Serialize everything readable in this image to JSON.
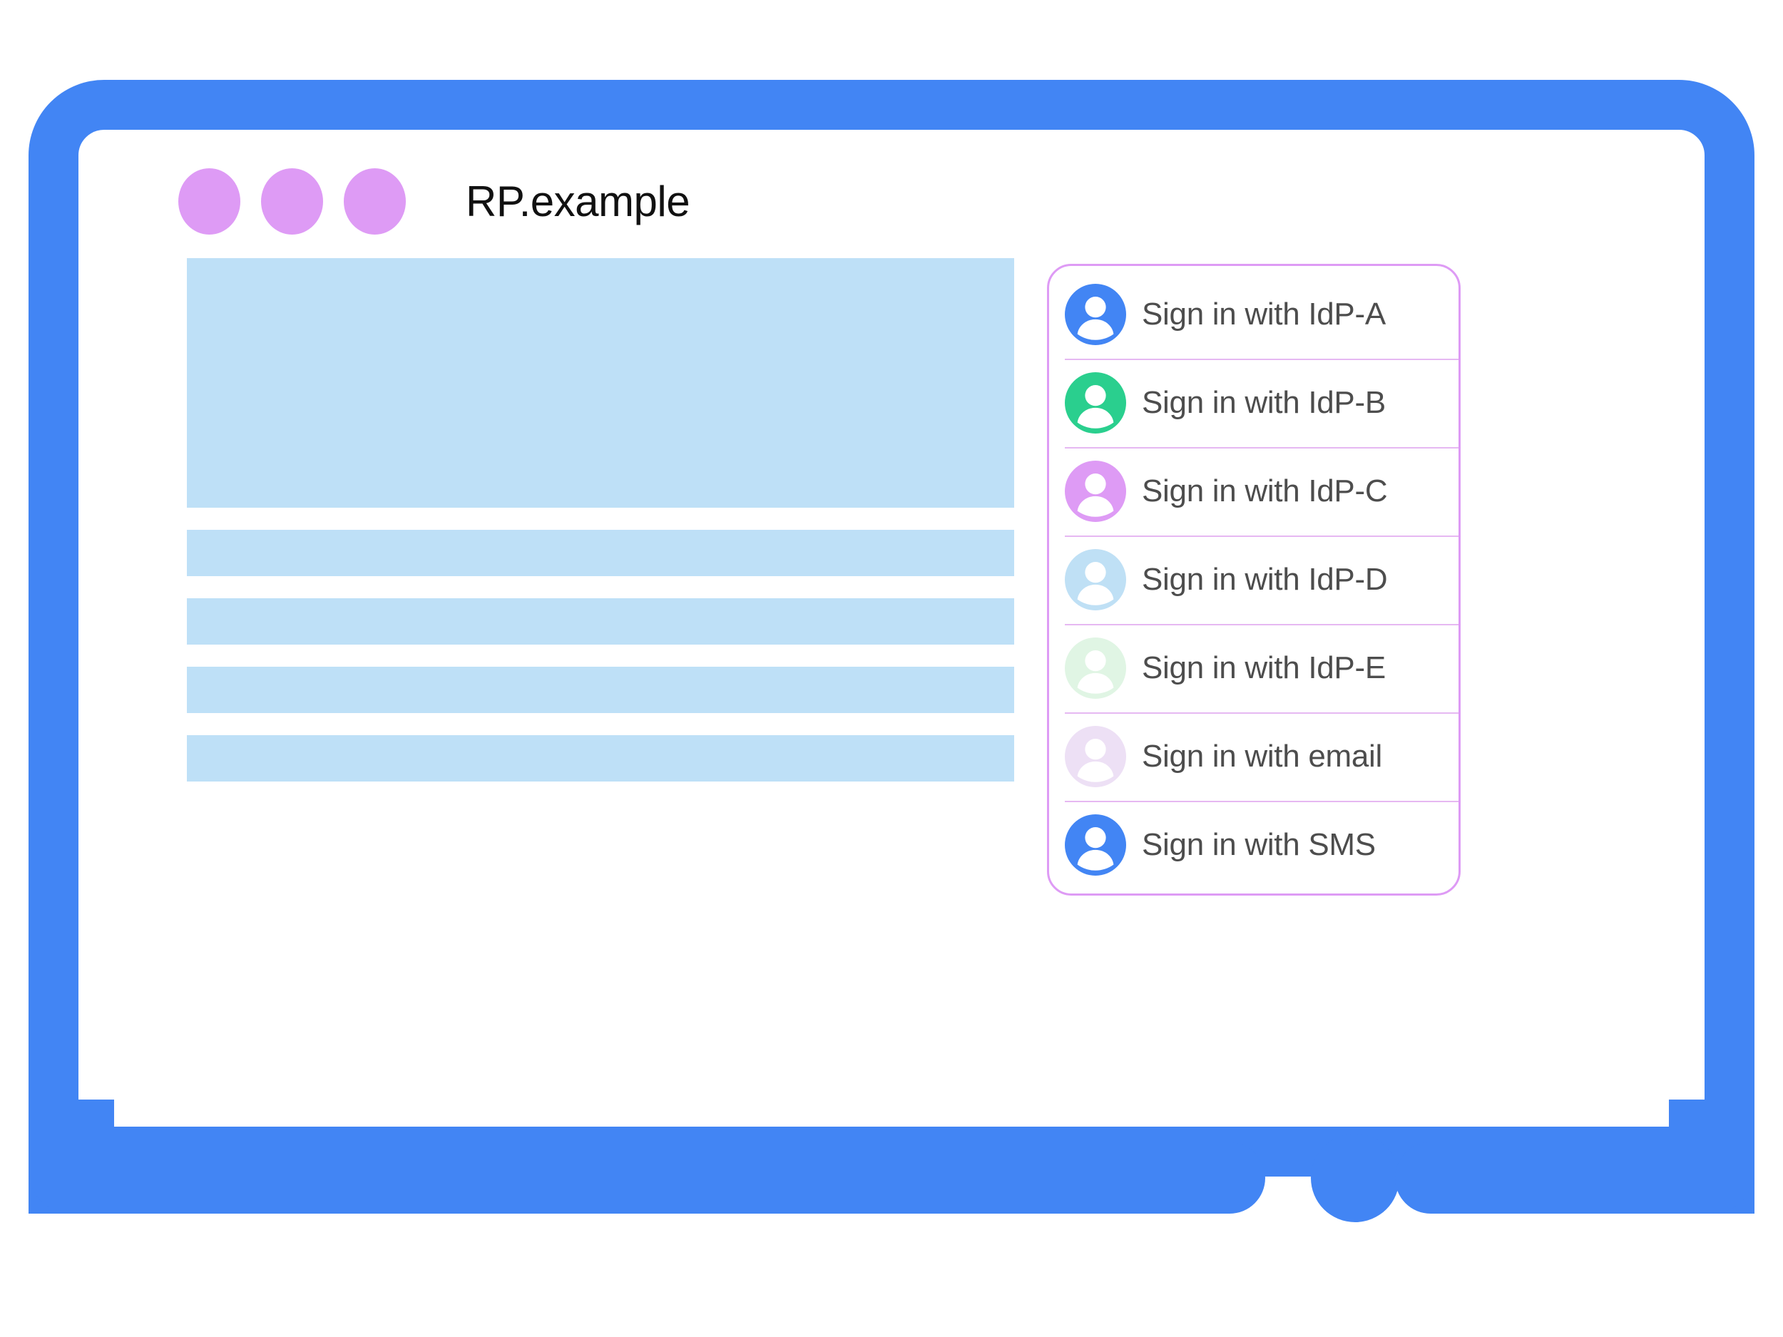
{
  "window": {
    "title": "RP.example",
    "traffic_dots": [
      "dot-1",
      "dot-2",
      "dot-3"
    ],
    "dot_color": "#DE9BF5",
    "frame_color": "#4285F4",
    "home_button_name": "home-button"
  },
  "content_skeleton": {
    "placeholder_color": "#BEE0F7",
    "blocks": [
      {
        "name": "hero-placeholder",
        "kind": "hero"
      },
      {
        "name": "text-line-placeholder-1",
        "kind": "bar"
      },
      {
        "name": "text-line-placeholder-2",
        "kind": "bar"
      },
      {
        "name": "text-line-placeholder-3",
        "kind": "bar"
      },
      {
        "name": "text-line-placeholder-4",
        "kind": "bar"
      }
    ]
  },
  "account_chooser": {
    "border_color": "#DE9BF5",
    "divider_color": "#E6B8F2",
    "label_color": "#4D4D4D",
    "items": [
      {
        "label": "Sign in with IdP-A",
        "icon": "person-avatar-icon",
        "avatar_color": "#4285F4",
        "name": "signin-idp-a"
      },
      {
        "label": "Sign in with IdP-B",
        "icon": "person-avatar-icon",
        "avatar_color": "#2ACF8E",
        "name": "signin-idp-b"
      },
      {
        "label": "Sign in with IdP-C",
        "icon": "person-avatar-icon",
        "avatar_color": "#DE9BF5",
        "name": "signin-idp-c"
      },
      {
        "label": "Sign in with IdP-D",
        "icon": "person-avatar-icon",
        "avatar_color": "#BFE0F5",
        "name": "signin-idp-d"
      },
      {
        "label": "Sign in with IdP-E",
        "icon": "person-avatar-icon",
        "avatar_color": "#E0F5E4",
        "name": "signin-idp-e"
      },
      {
        "label": "Sign in with email",
        "icon": "person-avatar-icon",
        "avatar_color": "#EDE0F5",
        "name": "signin-email"
      },
      {
        "label": "Sign in with SMS",
        "icon": "person-avatar-icon",
        "avatar_color": "#4285F4",
        "name": "signin-sms"
      }
    ]
  }
}
